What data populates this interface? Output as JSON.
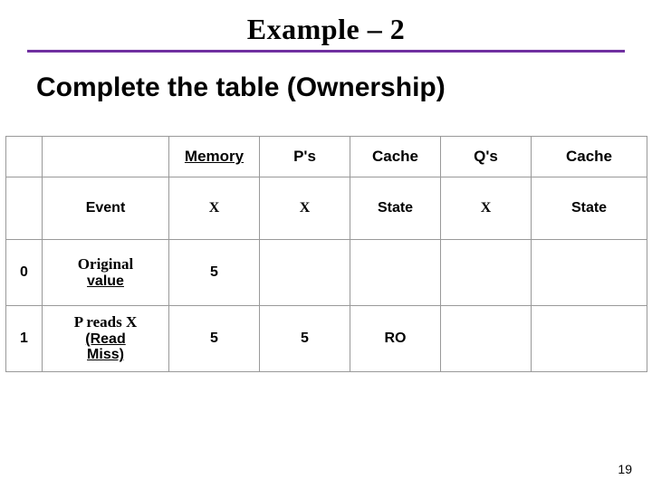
{
  "title": "Example – 2",
  "subtitle": "Complete the table (Ownership)",
  "page_number": "19",
  "headers_top": {
    "memory": "Memory",
    "ps": "P's",
    "cache_p": "Cache",
    "qs": "Q's",
    "cache_q": "Cache"
  },
  "headers_sub": {
    "event": "Event",
    "mem_x": "X",
    "p_x": "X",
    "p_state": "State",
    "q_x": "X",
    "q_state": "State"
  },
  "rows": [
    {
      "idx": "0",
      "event_line1": "Original",
      "event_line2": "value",
      "mem_x": "5",
      "p_x": "",
      "p_state": "",
      "q_x": "",
      "q_state": ""
    },
    {
      "idx": "1",
      "event_line1": "P reads X",
      "event_line2_a": "(Read",
      "event_line2_b": "Miss)",
      "mem_x": "5",
      "p_x": "5",
      "p_state": "RO",
      "q_x": "",
      "q_state": ""
    }
  ]
}
